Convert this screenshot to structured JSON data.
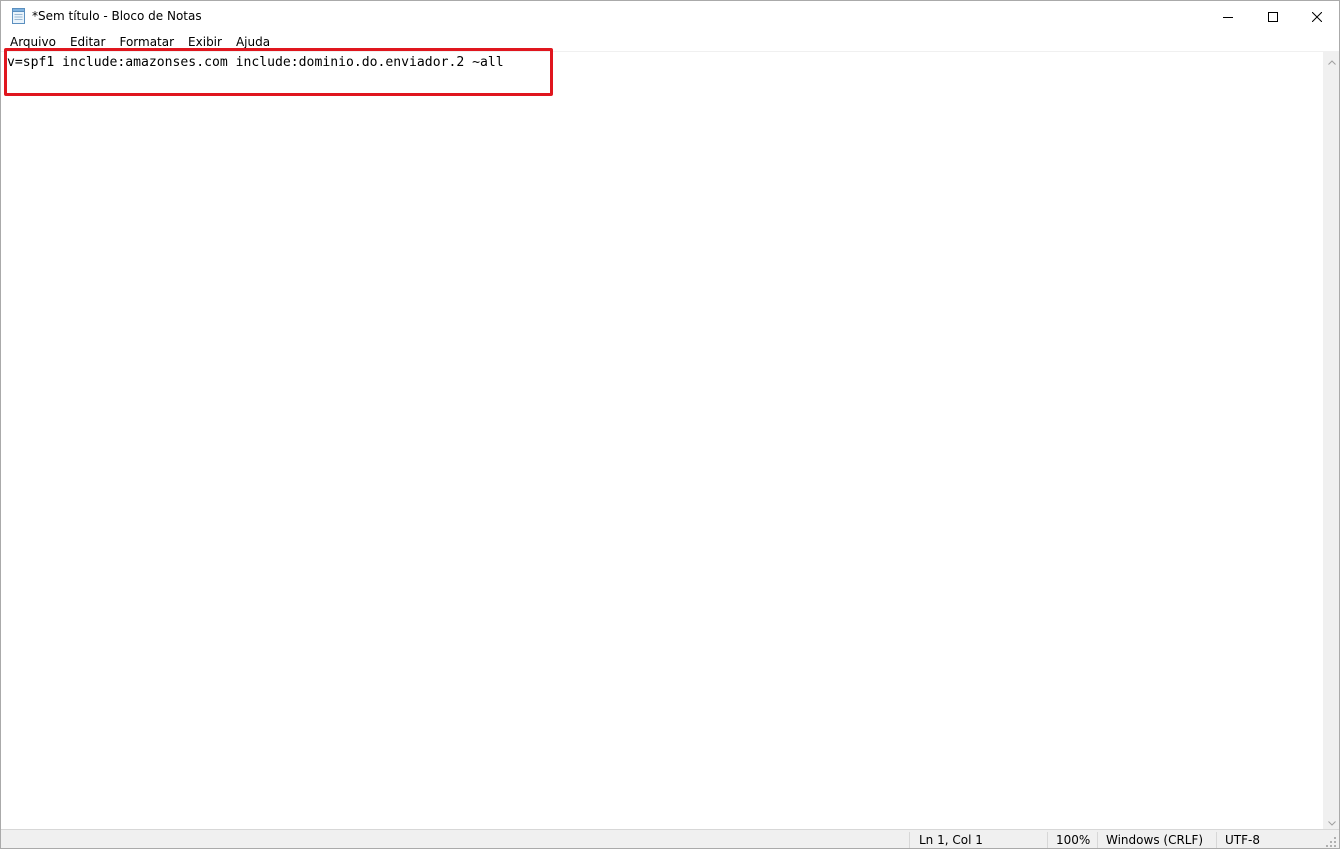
{
  "window": {
    "title": "*Sem título - Bloco de Notas",
    "app_icon": "notepad-icon"
  },
  "menu": {
    "items": [
      "Arquivo",
      "Editar",
      "Formatar",
      "Exibir",
      "Ajuda"
    ]
  },
  "editor": {
    "content": "v=spf1 include:amazonses.com include:dominio.do.enviador.2 ~all",
    "highlight_color": "#e0161e"
  },
  "status": {
    "position": "Ln 1, Col 1",
    "zoom": "100%",
    "line_ending": "Windows (CRLF)",
    "encoding": "UTF-8"
  }
}
